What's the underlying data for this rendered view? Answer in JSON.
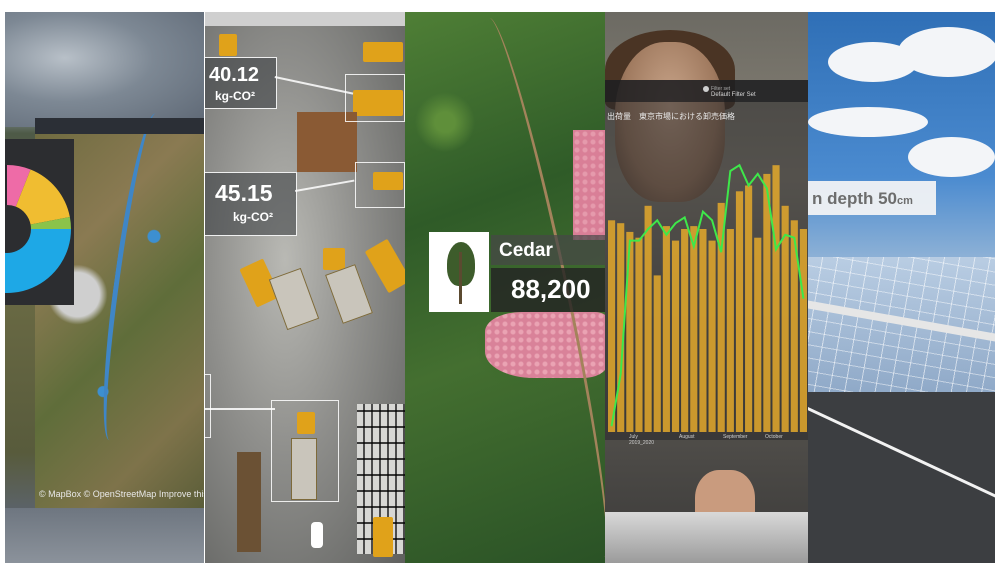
{
  "map_panel": {
    "credit": "© MapBox © OpenStreetMap Improve this map",
    "donut": {
      "slices": [
        {
          "value": 0.06,
          "color": "#ee6ba7"
        },
        {
          "value": 0.16,
          "color": "#f0bd31"
        },
        {
          "value": 0.03,
          "color": "#8bc34a"
        },
        {
          "value": 0.37,
          "color": "#1ea8e6"
        },
        {
          "value": 0.38,
          "color": "#26282c"
        }
      ]
    }
  },
  "construction_panel": {
    "emission_1": {
      "value": "40.12",
      "unit": "kg-CO²"
    },
    "emission_2": {
      "value": "45.15",
      "unit": "kg-CO²"
    }
  },
  "forest_panel": {
    "species": "Cedar",
    "count": "88,200"
  },
  "chart_panel": {
    "filter_label": "Filter set",
    "filter_value": "Default Filter Set",
    "title": "出荷量　東京市場における卸売価格",
    "chart_data": {
      "type": "bar",
      "bars": [
        0.73,
        0.72,
        0.69,
        0.67,
        0.78,
        0.54,
        0.71,
        0.66,
        0.7,
        0.71,
        0.7,
        0.66,
        0.79,
        0.7,
        0.83,
        0.85,
        0.67,
        0.89,
        0.92,
        0.78,
        0.73,
        0.7
      ],
      "line": [
        0.02,
        0.2,
        0.66,
        0.66,
        0.7,
        0.73,
        0.68,
        0.72,
        0.74,
        0.64,
        0.76,
        0.73,
        0.62,
        0.9,
        0.92,
        0.85,
        0.89,
        0.84,
        0.63,
        0.68,
        0.67,
        0.46
      ],
      "x_ticks": [
        "July\n2019_2020",
        "August",
        "September",
        "October"
      ],
      "bar_color": "#e4a92c",
      "line_color": "#3ee84a"
    }
  },
  "flood_panel": {
    "label": "n depth 50",
    "unit": "cm"
  }
}
